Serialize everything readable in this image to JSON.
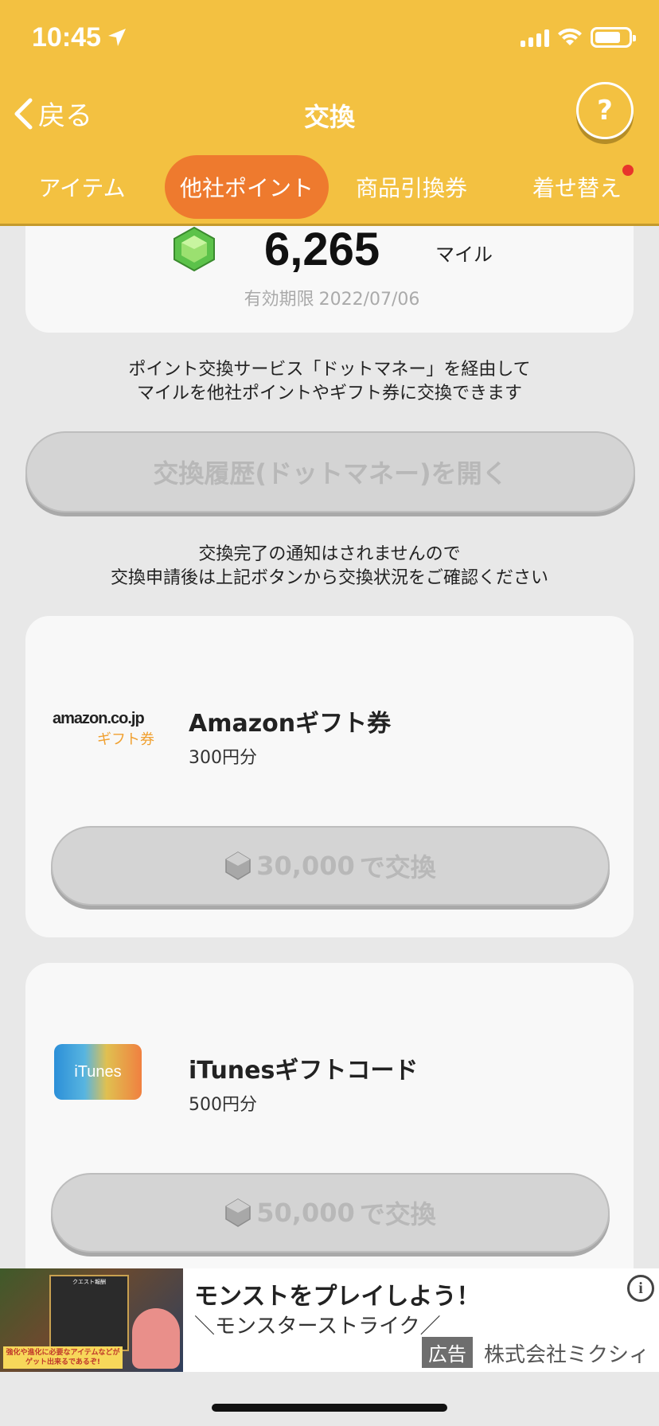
{
  "status_bar": {
    "time": "10:45"
  },
  "nav": {
    "back_label": "戻る",
    "title": "交換",
    "help_label": "?"
  },
  "tabs": [
    {
      "label": "アイテム",
      "active": false
    },
    {
      "label": "他社ポイント",
      "active": true
    },
    {
      "label": "商品引換券",
      "active": false
    },
    {
      "label": "着せ替え",
      "active": false,
      "badge": true
    }
  ],
  "points": {
    "value": "6,265",
    "unit": "マイル",
    "expiry_label": "有効期限",
    "expiry_date": "2022/07/06"
  },
  "intro": {
    "line1": "ポイント交換サービス「ドットマネー」を経由して",
    "line2": "マイルを他社ポイントやギフト券に交換できます"
  },
  "history_button": "交換履歴(ドットマネー)を開く",
  "notice": {
    "line1": "交換完了の通知はされませんので",
    "line2": "交換申請後は上記ボタンから交換状況をご確認ください"
  },
  "gifts": [
    {
      "logo_text_1": "amazon.co.jp",
      "logo_text_2": "ギフト券",
      "title": "Amazonギフト券",
      "sub": "300円分",
      "cost": "30,000",
      "cost_suffix": "で交換"
    },
    {
      "logo_text_1": "iTunes",
      "title": "iTunesギフトコード",
      "sub": "500円分",
      "cost": "50,000",
      "cost_suffix": "で交換"
    }
  ],
  "ad": {
    "title": "モンストをプレイしよう！",
    "subtitle": "＼モンスターストライク／",
    "tag": "広告",
    "company": "株式会社ミクシィ",
    "image_panel_title": "クエスト報酬",
    "image_caption": "強化や進化に必要なアイテムなどがゲット出来るであるぞ!"
  },
  "colors": {
    "header": "#f3c141",
    "active_tab": "#ee7a2e",
    "background": "#e8e8e8",
    "badge": "#e8342b"
  }
}
